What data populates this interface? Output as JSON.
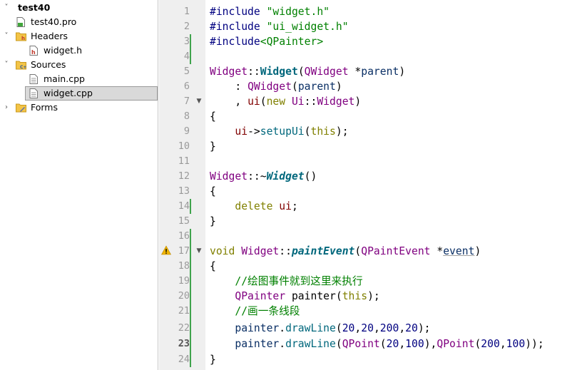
{
  "tree": {
    "items": [
      {
        "label": "test40",
        "chevron": "v",
        "bold": true
      },
      {
        "label": "test40.pro"
      },
      {
        "label": "Headers",
        "chevron": "v"
      },
      {
        "label": "widget.h"
      },
      {
        "label": "Sources",
        "chevron": "v"
      },
      {
        "label": "main.cpp"
      },
      {
        "label": "widget.cpp",
        "selected": true
      },
      {
        "label": "Forms",
        "chevron": ">"
      }
    ]
  },
  "editor": {
    "current_line": 23,
    "warning_line": 17,
    "lines": [
      {
        "n": "1"
      },
      {
        "n": "2"
      },
      {
        "n": "3"
      },
      {
        "n": "4"
      },
      {
        "n": "5"
      },
      {
        "n": "6"
      },
      {
        "n": "7"
      },
      {
        "n": "8"
      },
      {
        "n": "9"
      },
      {
        "n": "10"
      },
      {
        "n": "11"
      },
      {
        "n": "12"
      },
      {
        "n": "13"
      },
      {
        "n": "14"
      },
      {
        "n": "15"
      },
      {
        "n": "16"
      },
      {
        "n": "17"
      },
      {
        "n": "18"
      },
      {
        "n": "19"
      },
      {
        "n": "20"
      },
      {
        "n": "21"
      },
      {
        "n": "22"
      },
      {
        "n": "23"
      },
      {
        "n": "24"
      }
    ],
    "code": {
      "l1": [
        "#include ",
        "\"widget.h\""
      ],
      "l2": [
        "#include ",
        "\"ui_widget.h\""
      ],
      "l3": [
        "#include",
        "<QPainter>"
      ],
      "l5": [
        "Widget",
        "::",
        "Widget",
        "(",
        "QWidget",
        " *",
        "parent",
        ")"
      ],
      "l6": [
        "    : ",
        "QWidget",
        "(",
        "parent",
        ")"
      ],
      "l7": [
        "    , ",
        "ui",
        "(",
        "new",
        " ",
        "Ui",
        "::",
        "Widget",
        ")"
      ],
      "l8": [
        "{"
      ],
      "l9": [
        "    ",
        "ui",
        "->",
        "setupUi",
        "(",
        "this",
        ");"
      ],
      "l10": [
        "}"
      ],
      "l12": [
        "Widget",
        "::~",
        "Widget",
        "()"
      ],
      "l13": [
        "{"
      ],
      "l14": [
        "    ",
        "delete",
        " ",
        "ui",
        ";"
      ],
      "l15": [
        "}"
      ],
      "l17": [
        "void",
        " ",
        "Widget",
        "::",
        "paintEvent",
        "(",
        "QPaintEvent",
        " *",
        "event",
        ")"
      ],
      "l18": [
        "{"
      ],
      "l19": [
        "    ",
        "//绘图事件就到这里来执行"
      ],
      "l20": [
        "    ",
        "QPainter",
        " ",
        "painter",
        "(",
        "this",
        ");"
      ],
      "l21": [
        "    ",
        "//画一条线段"
      ],
      "l22": [
        "    ",
        "painter",
        ".",
        "drawLine",
        "(",
        "20",
        ",",
        "20",
        ",",
        "200",
        ",",
        "20",
        ");"
      ],
      "l23": [
        "    ",
        "painter",
        ".",
        "drawLine",
        "(",
        "QPoint",
        "(",
        "20",
        ",",
        "100",
        "),",
        "QPoint",
        "(",
        "200",
        ",",
        "100",
        "));"
      ],
      "l24": [
        "}"
      ]
    }
  }
}
